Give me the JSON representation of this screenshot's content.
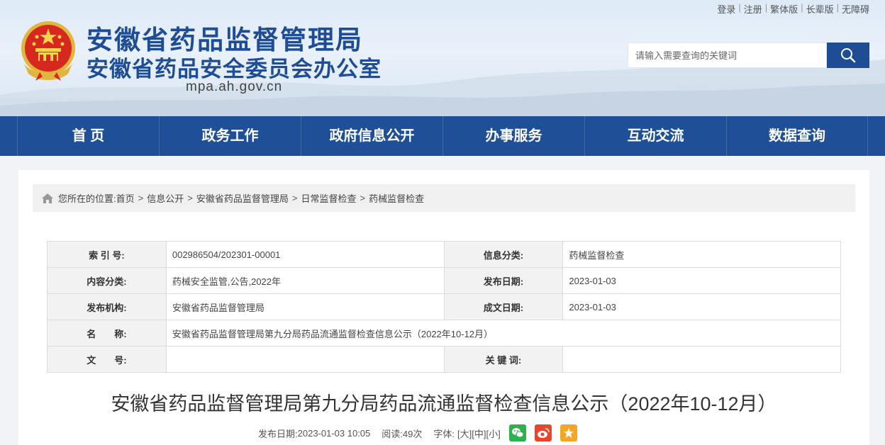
{
  "header": {
    "title_main": "安徽省药品监督管理局",
    "title_sub": "安徽省药品安全委员会办公室",
    "domain": "mpa.ah.gov.cn",
    "top_links": [
      "登录",
      "注册",
      "繁体版",
      "长辈版",
      "无障碍"
    ],
    "search_placeholder": "请输入需要查询的关键词"
  },
  "nav": [
    "首 页",
    "政务工作",
    "政府信息公开",
    "办事服务",
    "互动交流",
    "数据查询"
  ],
  "breadcrumb": {
    "prefix": "您所在的位置:",
    "items": [
      "首页",
      "信息公开",
      "安徽省药品监督管理局",
      "日常监督检查",
      "药械监督检查"
    ]
  },
  "info_table": {
    "index_label": "索 引 号:",
    "index_value": "002986504/202301-00001",
    "category_label": "信息分类:",
    "category_value": "药械监督检查",
    "content_label": "内容分类:",
    "content_value": "药械安全监管,公告,2022年",
    "publish_label": "发布日期:",
    "publish_value": "2023-01-03",
    "org_label": "发布机构:",
    "org_value": "安徽省药品监督管理局",
    "created_label": "成文日期:",
    "created_value": "2023-01-03",
    "name_label": "名　　称:",
    "name_value": "安徽省药品监督管理局第九分局药品流通监督检查信息公示（2022年10-12月）",
    "doc_label": "文　　号:",
    "doc_value": "",
    "keyword_label": "关 键 词:",
    "keyword_value": ""
  },
  "article": {
    "title": "安徽省药品监督管理局第九分局药品流通监督检查信息公示（2022年10-12月）",
    "date_label": "发布日期:",
    "date_value": "2023-01-03 10:05",
    "reads_label": "阅读:",
    "reads_value": "49次",
    "font_label": "字体:",
    "font_large": "[大]",
    "font_medium": "[中]",
    "font_small": "[小]"
  },
  "colors": {
    "brand_blue": "#1f4f96",
    "wechat": "#2bb24c",
    "weibo": "#e6452e",
    "favorite": "#f5a623"
  },
  "icons": [
    "national-emblem-icon",
    "search-icon",
    "home-icon",
    "wechat-icon",
    "weibo-icon",
    "favorite-icon"
  ]
}
